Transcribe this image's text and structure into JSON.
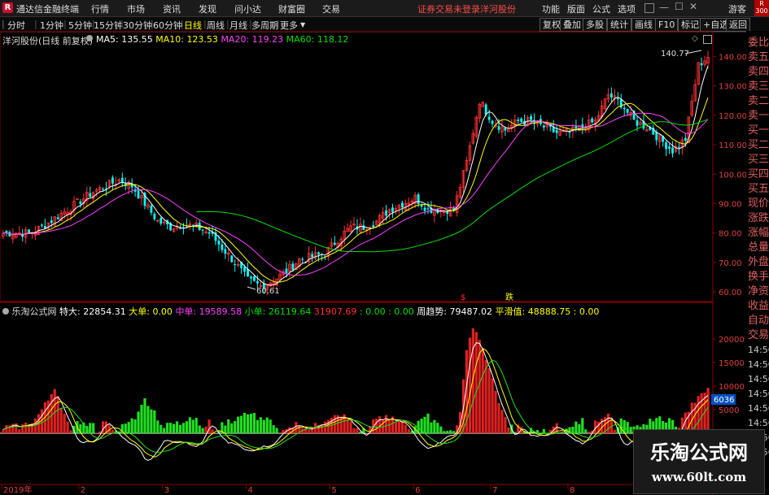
{
  "app": {
    "title": "通达信金融终端",
    "logo": "R"
  },
  "menu": [
    "行情",
    "市场",
    "资讯",
    "发现",
    "问小达",
    "财富圈",
    "交易"
  ],
  "menu_right": [
    "功能",
    "版面",
    "公式",
    "选项"
  ],
  "notice": {
    "login": "证券交易未登录",
    "stock": "洋河股份"
  },
  "user": "游客",
  "market_badge": {
    "top": "R",
    "bottom": "300"
  },
  "periods": [
    "分时",
    "1分钟",
    "5分钟",
    "15分钟",
    "30分钟",
    "60分钟",
    "日线",
    "周线",
    "月线",
    "多周期",
    "更多"
  ],
  "active_period": "日线",
  "toolbar_right": [
    "复权",
    "叠加",
    "多股",
    "统计",
    "画线",
    "F10",
    "标记",
    "+自选",
    "返回"
  ],
  "main_chart": {
    "stock_label": "洋河股份(日线 前复权)",
    "ma": [
      {
        "name": "MA5",
        "value": "135.55",
        "color": "#ffffff"
      },
      {
        "name": "MA10",
        "value": "123.53",
        "color": "#ffff00"
      },
      {
        "name": "MA20",
        "value": "119.23",
        "color": "#ff40ff"
      },
      {
        "name": "MA60",
        "value": "118.12",
        "color": "#00e000"
      }
    ],
    "high_label": "140.77",
    "low_label": "60.61",
    "event_labels": [
      {
        "text": "$",
        "color": "#ff3030"
      },
      {
        "text": "跌",
        "color": "#ffff00"
      }
    ]
  },
  "sub_chart": {
    "name": "乐淘公式网",
    "fields": [
      {
        "label": "特大:",
        "value": "22854.31",
        "color": "#ffffff"
      },
      {
        "label": "大单:",
        "value": "0.00",
        "color": "#ffff00"
      },
      {
        "label": "中单:",
        "value": "19589.58",
        "color": "#ff40ff"
      },
      {
        "label": "小单:",
        "value": "26119.64",
        "color": "#00e000"
      },
      {
        "label": "",
        "value": "31907.69",
        "color": "#ff3030"
      },
      {
        "label": "",
        "value": ": 0.00 : 0.00",
        "color": "#00e000"
      },
      {
        "label": "周趋势:",
        "value": "79487.02",
        "color": "#ffffff"
      },
      {
        "label": "平滑值:",
        "value": "48888.75 : 0.00",
        "color": "#ffff00"
      }
    ],
    "current_tag": "6036"
  },
  "right_panel": [
    "委比",
    "卖五",
    "卖四",
    "卖三",
    "卖二",
    "卖一",
    "买一",
    "买二",
    "买三",
    "买四",
    "买五",
    "现价",
    "涨跌",
    "涨幅",
    "总量",
    "外盘",
    "换手",
    "净资",
    "收益"
  ],
  "right_panel2": [
    "自动",
    "交易",
    "14:56",
    "14:56",
    "14:56",
    "14:56",
    "14:56",
    "14:56",
    "14:56",
    "14:56"
  ],
  "watermark": {
    "title": "乐淘公式网",
    "url": "www.60lt.com"
  },
  "chart_data": [
    {
      "type": "candlestick",
      "ylim": [
        57,
        144
      ],
      "yticks": [
        60,
        70,
        80,
        90,
        100,
        110,
        120,
        130,
        140
      ],
      "ytick_labels": [
        "60.00",
        "70.00",
        "80.00",
        "90.00",
        "100.00",
        "110.00",
        "120.00",
        "130.00",
        "140.00"
      ],
      "close_anchors": [
        [
          0,
          80
        ],
        [
          8,
          80
        ],
        [
          12,
          82
        ],
        [
          20,
          88
        ],
        [
          28,
          94
        ],
        [
          36,
          98
        ],
        [
          40,
          96
        ],
        [
          44,
          90
        ],
        [
          48,
          84
        ],
        [
          52,
          82
        ],
        [
          56,
          83
        ],
        [
          60,
          82
        ],
        [
          64,
          80
        ],
        [
          68,
          75
        ],
        [
          72,
          70
        ],
        [
          76,
          64
        ],
        [
          80,
          62
        ],
        [
          84,
          64
        ],
        [
          88,
          67
        ],
        [
          92,
          71
        ],
        [
          96,
          72
        ],
        [
          100,
          73
        ],
        [
          104,
          78
        ],
        [
          108,
          82
        ],
        [
          112,
          82
        ],
        [
          116,
          84
        ],
        [
          120,
          88
        ],
        [
          124,
          90
        ],
        [
          128,
          92
        ],
        [
          132,
          88
        ],
        [
          136,
          88
        ],
        [
          140,
          88
        ],
        [
          144,
          104
        ],
        [
          148,
          125
        ],
        [
          152,
          118
        ],
        [
          156,
          115
        ],
        [
          160,
          118
        ],
        [
          164,
          118
        ],
        [
          168,
          116
        ],
        [
          172,
          114
        ],
        [
          176,
          114
        ],
        [
          180,
          116
        ],
        [
          184,
          118
        ],
        [
          188,
          127
        ],
        [
          192,
          124
        ],
        [
          196,
          118
        ],
        [
          200,
          116
        ],
        [
          204,
          112
        ],
        [
          208,
          108
        ],
        [
          212,
          112
        ],
        [
          216,
          137
        ],
        [
          219,
          140
        ]
      ],
      "series": [
        {
          "name": "MA5"
        },
        {
          "name": "MA10"
        },
        {
          "name": "MA20"
        },
        {
          "name": "MA60"
        }
      ]
    },
    {
      "type": "bar",
      "ylim": [
        -10000,
        25000
      ],
      "yticks": [
        5000,
        10000,
        15000,
        20000
      ],
      "ytick_labels": [
        "5000",
        "10000",
        "15000",
        "20000"
      ],
      "anchors": [
        [
          0,
          1200
        ],
        [
          6,
          1500
        ],
        [
          10,
          3000
        ],
        [
          14,
          7000
        ],
        [
          16,
          10000
        ],
        [
          18,
          6000
        ],
        [
          22,
          -2000
        ],
        [
          28,
          -1500
        ],
        [
          32,
          3000
        ],
        [
          38,
          -2500
        ],
        [
          42,
          -4000
        ],
        [
          44,
          -8000
        ],
        [
          46,
          -5000
        ],
        [
          50,
          -1500
        ],
        [
          56,
          -2500
        ],
        [
          60,
          -3500
        ],
        [
          64,
          2500
        ],
        [
          68,
          -2000
        ],
        [
          72,
          -3000
        ],
        [
          76,
          -4500
        ],
        [
          80,
          -3000
        ],
        [
          84,
          -2200
        ],
        [
          88,
          1500
        ],
        [
          92,
          2000
        ],
        [
          96,
          1000
        ],
        [
          100,
          3000
        ],
        [
          104,
          4500
        ],
        [
          108,
          2500
        ],
        [
          112,
          -1500
        ],
        [
          116,
          3500
        ],
        [
          120,
          3000
        ],
        [
          124,
          2500
        ],
        [
          128,
          -1500
        ],
        [
          132,
          -3500
        ],
        [
          136,
          -1000
        ],
        [
          140,
          -500
        ],
        [
          142,
          5000
        ],
        [
          144,
          17000
        ],
        [
          146,
          23000
        ],
        [
          148,
          20000
        ],
        [
          150,
          16000
        ],
        [
          152,
          11000
        ],
        [
          154,
          7000
        ],
        [
          156,
          3000
        ],
        [
          158,
          -2000
        ],
        [
          160,
          1500
        ],
        [
          164,
          -1000
        ],
        [
          168,
          -500
        ],
        [
          172,
          1500
        ],
        [
          176,
          -1500
        ],
        [
          180,
          -2500
        ],
        [
          184,
          2500
        ],
        [
          188,
          4500
        ],
        [
          192,
          -3500
        ],
        [
          196,
          -1500
        ],
        [
          200,
          -2500
        ],
        [
          204,
          -3000
        ],
        [
          208,
          -2500
        ],
        [
          212,
          4500
        ],
        [
          216,
          7500
        ],
        [
          219,
          10000
        ]
      ],
      "series": [
        {
          "name": "特大"
        },
        {
          "name": "周趋势"
        },
        {
          "name": "平滑值"
        }
      ]
    }
  ],
  "x_axis": {
    "labels": [
      "2019年",
      "2",
      "3",
      "4",
      "5",
      "6",
      "7",
      "8",
      "9"
    ],
    "positions": [
      0,
      24,
      50,
      76,
      102,
      128,
      152,
      176,
      200
    ]
  }
}
